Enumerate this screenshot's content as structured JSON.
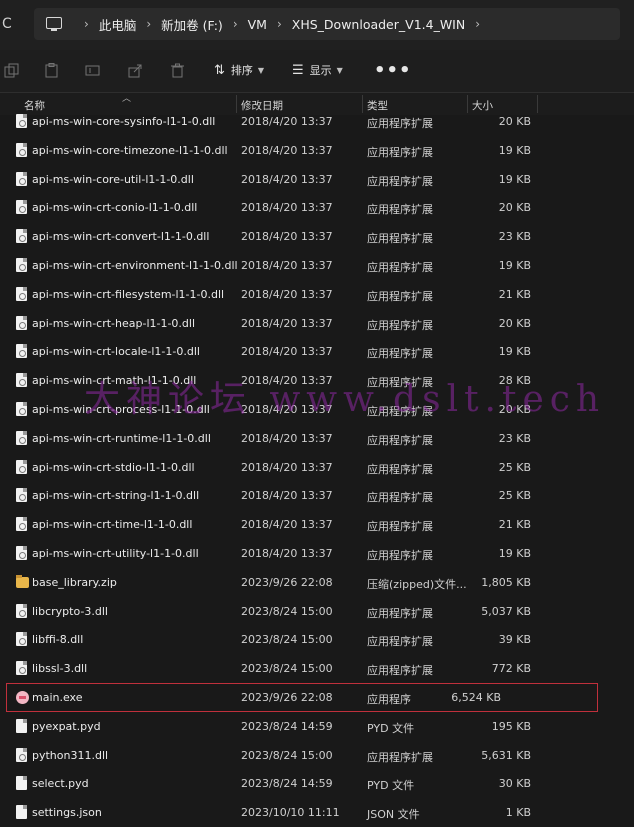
{
  "address": {
    "refresh_glyph": "C",
    "crumbs": [
      "此电脑",
      "新加卷 (F:)",
      "VM",
      "XHS_Downloader_V1.4_WIN"
    ]
  },
  "toolbar": {
    "sort_label": "排序",
    "view_label": "显示",
    "more_glyph": "•••"
  },
  "columns": {
    "name": "名称",
    "date": "修改日期",
    "type": "类型",
    "size": "大小"
  },
  "files": [
    {
      "name": "api-ms-win-core-sysinfo-l1-1-0.dll",
      "date": "2018/4/20 13:37",
      "type": "应用程序扩展",
      "size": "20 KB",
      "kind": "dll"
    },
    {
      "name": "api-ms-win-core-timezone-l1-1-0.dll",
      "date": "2018/4/20 13:37",
      "type": "应用程序扩展",
      "size": "19 KB",
      "kind": "dll"
    },
    {
      "name": "api-ms-win-core-util-l1-1-0.dll",
      "date": "2018/4/20 13:37",
      "type": "应用程序扩展",
      "size": "19 KB",
      "kind": "dll"
    },
    {
      "name": "api-ms-win-crt-conio-l1-1-0.dll",
      "date": "2018/4/20 13:37",
      "type": "应用程序扩展",
      "size": "20 KB",
      "kind": "dll"
    },
    {
      "name": "api-ms-win-crt-convert-l1-1-0.dll",
      "date": "2018/4/20 13:37",
      "type": "应用程序扩展",
      "size": "23 KB",
      "kind": "dll"
    },
    {
      "name": "api-ms-win-crt-environment-l1-1-0.dll",
      "date": "2018/4/20 13:37",
      "type": "应用程序扩展",
      "size": "19 KB",
      "kind": "dll"
    },
    {
      "name": "api-ms-win-crt-filesystem-l1-1-0.dll",
      "date": "2018/4/20 13:37",
      "type": "应用程序扩展",
      "size": "21 KB",
      "kind": "dll"
    },
    {
      "name": "api-ms-win-crt-heap-l1-1-0.dll",
      "date": "2018/4/20 13:37",
      "type": "应用程序扩展",
      "size": "20 KB",
      "kind": "dll"
    },
    {
      "name": "api-ms-win-crt-locale-l1-1-0.dll",
      "date": "2018/4/20 13:37",
      "type": "应用程序扩展",
      "size": "19 KB",
      "kind": "dll"
    },
    {
      "name": "api-ms-win-crt-math-l1-1-0.dll",
      "date": "2018/4/20 13:37",
      "type": "应用程序扩展",
      "size": "28 KB",
      "kind": "dll"
    },
    {
      "name": "api-ms-win-crt-process-l1-1-0.dll",
      "date": "2018/4/20 13:37",
      "type": "应用程序扩展",
      "size": "20 KB",
      "kind": "dll"
    },
    {
      "name": "api-ms-win-crt-runtime-l1-1-0.dll",
      "date": "2018/4/20 13:37",
      "type": "应用程序扩展",
      "size": "23 KB",
      "kind": "dll"
    },
    {
      "name": "api-ms-win-crt-stdio-l1-1-0.dll",
      "date": "2018/4/20 13:37",
      "type": "应用程序扩展",
      "size": "25 KB",
      "kind": "dll"
    },
    {
      "name": "api-ms-win-crt-string-l1-1-0.dll",
      "date": "2018/4/20 13:37",
      "type": "应用程序扩展",
      "size": "25 KB",
      "kind": "dll"
    },
    {
      "name": "api-ms-win-crt-time-l1-1-0.dll",
      "date": "2018/4/20 13:37",
      "type": "应用程序扩展",
      "size": "21 KB",
      "kind": "dll"
    },
    {
      "name": "api-ms-win-crt-utility-l1-1-0.dll",
      "date": "2018/4/20 13:37",
      "type": "应用程序扩展",
      "size": "19 KB",
      "kind": "dll"
    },
    {
      "name": "base_library.zip",
      "date": "2023/9/26 22:08",
      "type": "压缩(zipped)文件...",
      "size": "1,805 KB",
      "kind": "zip"
    },
    {
      "name": "libcrypto-3.dll",
      "date": "2023/8/24 15:00",
      "type": "应用程序扩展",
      "size": "5,037 KB",
      "kind": "dll"
    },
    {
      "name": "libffi-8.dll",
      "date": "2023/8/24 15:00",
      "type": "应用程序扩展",
      "size": "39 KB",
      "kind": "dll"
    },
    {
      "name": "libssl-3.dll",
      "date": "2023/8/24 15:00",
      "type": "应用程序扩展",
      "size": "772 KB",
      "kind": "dll"
    },
    {
      "name": "main.exe",
      "date": "2023/9/26 22:08",
      "type": "应用程序",
      "size": "6,524 KB",
      "kind": "exe",
      "highlight": true
    },
    {
      "name": "pyexpat.pyd",
      "date": "2023/8/24 14:59",
      "type": "PYD 文件",
      "size": "195 KB",
      "kind": "file"
    },
    {
      "name": "python311.dll",
      "date": "2023/8/24 15:00",
      "type": "应用程序扩展",
      "size": "5,631 KB",
      "kind": "dll"
    },
    {
      "name": "select.pyd",
      "date": "2023/8/24 14:59",
      "type": "PYD 文件",
      "size": "30 KB",
      "kind": "file"
    },
    {
      "name": "settings.json",
      "date": "2023/10/10 11:11",
      "type": "JSON 文件",
      "size": "1 KB",
      "kind": "file"
    }
  ],
  "watermark": "大神论坛  www.dslt.tech",
  "colors": {
    "background": "#191919",
    "highlight_border": "#c0303c",
    "watermark": "#8c28a0"
  }
}
